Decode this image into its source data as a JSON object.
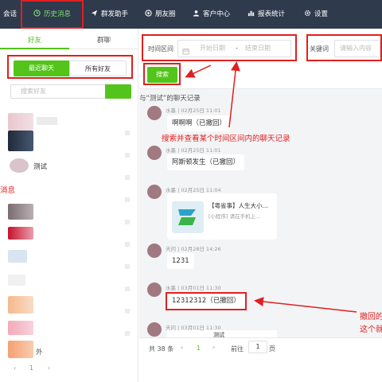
{
  "topnav": {
    "items": [
      {
        "label": "会话"
      },
      {
        "label": "历史消息"
      },
      {
        "label": "群发助手"
      },
      {
        "label": "朋友圈"
      },
      {
        "label": "客户中心"
      },
      {
        "label": "报表统计"
      },
      {
        "label": "设置"
      }
    ],
    "active_color": "#7be36b",
    "bar_color": "#2f3a4d"
  },
  "left": {
    "tabs": {
      "friends": "好友",
      "groups": "群聊"
    },
    "segment": {
      "recent": "最近聊天",
      "all": "所有好友"
    },
    "search_placeholder": "搜索好友",
    "contacts": [
      {
        "name": ""
      },
      {
        "name": ""
      },
      {
        "name": "测试"
      },
      {
        "name": ""
      },
      {
        "name": ""
      },
      {
        "name": ""
      },
      {
        "name": ""
      },
      {
        "name": ""
      },
      {
        "name": ""
      },
      {
        "name": "外"
      }
    ],
    "side_label": "消息",
    "pager": {
      "page": "1"
    }
  },
  "filter": {
    "time_label": "时间区间",
    "start_placeholder": "开始日期",
    "dash": "-",
    "end_placeholder": "结束日期",
    "keyword_label": "关键词",
    "keyword_placeholder": "请输入内容",
    "search_button": "搜索"
  },
  "chat": {
    "title": "与“测试”的聊天记录",
    "messages": [
      {
        "sender": "水墨",
        "time": "02月25日 11:01",
        "text": "啊啊啊（已撤回）"
      },
      {
        "sender": "水墨",
        "time": "02月25日 11:01",
        "text": "阿斯顿发生（已撤回）"
      },
      {
        "sender": "水墨",
        "time": "02月25日 11:04",
        "card_title": "【粤省事】人生大小...",
        "card_sub": "[小程序] 请在手机上..."
      },
      {
        "sender": "天问",
        "time": "02月28日 14:26",
        "text": "1231"
      },
      {
        "sender": "水墨",
        "time": "03月01日 11:30",
        "text": "12312312（已撤回）"
      },
      {
        "sender": "天问",
        "time": "03月01日 11:30",
        "screenshot_title": "测试"
      }
    ]
  },
  "pager": {
    "total": "共 38 条",
    "page": "1",
    "goto": "前往",
    "goto_value": "1",
    "unit": "页"
  },
  "annotations": {
    "search_note": "搜索并查看某个时间区间内的聊天记录",
    "recall_note_1": "撤回的",
    "recall_note_2": "这个就"
  },
  "colors": {
    "accent": "#52c41a",
    "annotation": "#e02020"
  }
}
